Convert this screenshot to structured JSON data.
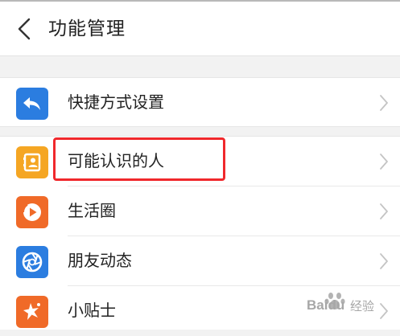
{
  "header": {
    "title": "功能管理"
  },
  "groups": [
    {
      "items": [
        {
          "label": "快捷方式设置",
          "icon": "shortcut-arrow-icon",
          "icon_color": "#2b7de0"
        }
      ]
    },
    {
      "items": [
        {
          "label": "可能认识的人",
          "icon": "contact-card-icon",
          "icon_color": "#f5a623",
          "highlighted": true
        },
        {
          "label": "生活圈",
          "icon": "play-circle-icon",
          "icon_color": "#f06a28"
        },
        {
          "label": "朋友动态",
          "icon": "aperture-icon",
          "icon_color": "#2b7de0"
        },
        {
          "label": "小贴士",
          "icon": "star-burst-icon",
          "icon_color": "#f06a28"
        }
      ]
    }
  ],
  "highlight_color": "#f0282c",
  "watermark": {
    "brand": "Baidu",
    "sub": "经验"
  }
}
